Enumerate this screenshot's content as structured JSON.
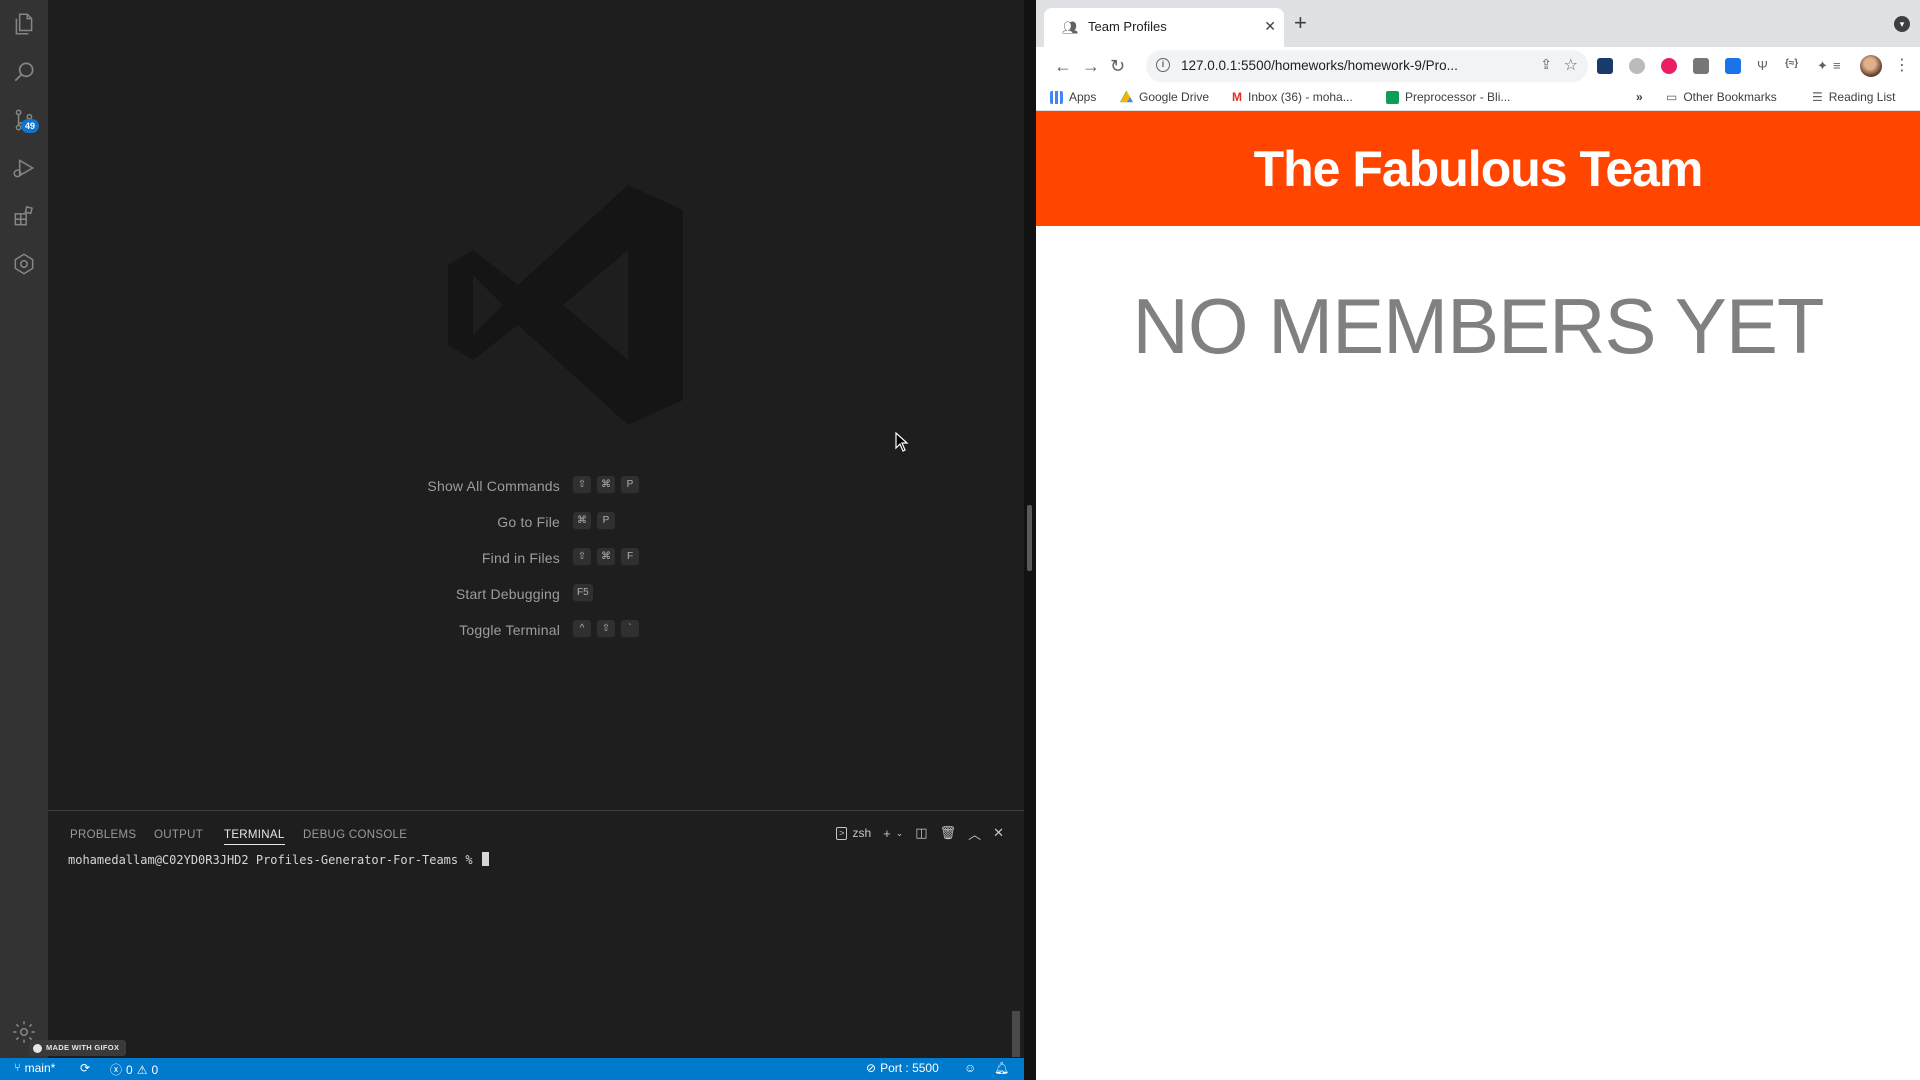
{
  "vscode": {
    "source_control_badge": "49",
    "shortcuts": [
      {
        "label": "Show All Commands",
        "keys": [
          "⇧",
          "⌘",
          "P"
        ]
      },
      {
        "label": "Go to File",
        "keys": [
          "⌘",
          "P"
        ]
      },
      {
        "label": "Find in Files",
        "keys": [
          "⇧",
          "⌘",
          "F"
        ]
      },
      {
        "label": "Start Debugging",
        "keys": [
          "F5"
        ]
      },
      {
        "label": "Toggle Terminal",
        "keys": [
          "^",
          "⇧",
          "`"
        ]
      }
    ],
    "panel": {
      "tabs": [
        "PROBLEMS",
        "OUTPUT",
        "TERMINAL",
        "DEBUG CONSOLE"
      ],
      "active_tab": "TERMINAL",
      "shell": "zsh",
      "terminal_prompt": "mohamedallam@C02YD0R3JHD2 Profiles-Generator-For-Teams % "
    },
    "status_bar": {
      "branch": "main*",
      "errors": "0",
      "warnings": "0",
      "port": "Port : 5500"
    },
    "gifox_label": "MADE WITH GIFOX",
    "status_color": "#007acc"
  },
  "browser": {
    "tab_title": "Team Profiles",
    "url": "127.0.0.1:5500/homeworks/homework-9/Pro...",
    "bookmarks": [
      {
        "label": "Apps",
        "icon": "apps-grid-icon"
      },
      {
        "label": "Google Drive",
        "icon": "google-drive-icon"
      },
      {
        "label": "Inbox (36) - moha...",
        "icon": "gmail-icon"
      },
      {
        "label": "Preprocessor - Bli...",
        "icon": "sheets-icon"
      }
    ],
    "other_bookmarks": "Other Bookmarks",
    "reading_list": "Reading List"
  },
  "page": {
    "header_title": "The Fabulous Team",
    "empty_message": "NO MEMBERS YET",
    "header_color": "#ff4500"
  }
}
